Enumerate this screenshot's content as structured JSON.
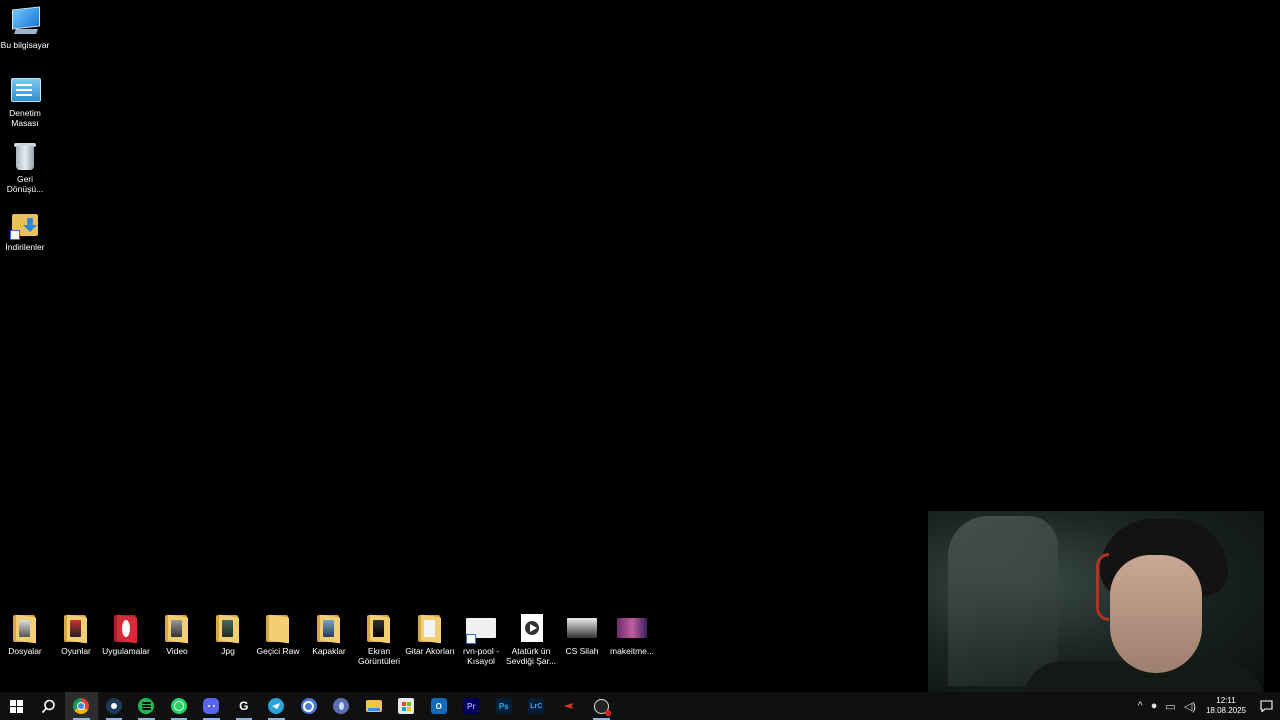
{
  "desktop": {
    "left_icons": [
      {
        "label": "Bu bilgisayar"
      },
      {
        "label": "Denetim Masası"
      },
      {
        "label": "Geri Dönüşü..."
      },
      {
        "label": "İndirilenler"
      }
    ],
    "bottom_icons": [
      {
        "label": "Dosyalar"
      },
      {
        "label": "Oyunlar"
      },
      {
        "label": "Uygulamalar"
      },
      {
        "label": "Video"
      },
      {
        "label": "Jpg"
      },
      {
        "label": "Geçici Raw"
      },
      {
        "label": "Kapaklar"
      },
      {
        "label": "Ekran Görüntüleri"
      },
      {
        "label": "Gitar Akorları"
      },
      {
        "label": "rvn-pool - Kısayol"
      },
      {
        "label": "Atatürk ün Sevdiği Şar..."
      },
      {
        "label": "CS Silah"
      },
      {
        "label": "makeitme..."
      }
    ]
  },
  "taskbar": {
    "apps": [
      {
        "name": "chrome-icon"
      },
      {
        "name": "steam-icon"
      },
      {
        "name": "spotify-icon"
      },
      {
        "name": "whatsapp-icon"
      },
      {
        "name": "discord-icon"
      },
      {
        "name": "ghub-icon"
      },
      {
        "name": "telegram-icon"
      },
      {
        "name": "chrome-alt-icon"
      },
      {
        "name": "app-icon"
      },
      {
        "name": "file-explorer-icon"
      },
      {
        "name": "store-icon"
      },
      {
        "name": "outlook-icon"
      },
      {
        "name": "premiere-icon",
        "text": "Pr"
      },
      {
        "name": "photoshop-icon",
        "text": "Ps"
      },
      {
        "name": "lightroom-icon",
        "text": "LrC"
      },
      {
        "name": "arrow-app-icon"
      },
      {
        "name": "obs-icon"
      }
    ],
    "clock": {
      "time": "12:11",
      "date": "18.08.2025"
    }
  },
  "colors": {
    "taskbar_bg": "#101010",
    "desktop_bg": "#000000",
    "folder_yellow": "#f2cf72"
  }
}
